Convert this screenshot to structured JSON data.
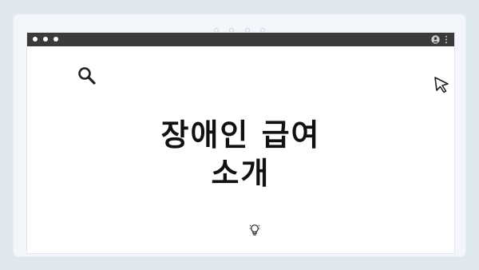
{
  "carousel": {
    "dot_count": 4
  },
  "browser_window": {
    "titlebar_buttons": [
      "dot",
      "dot",
      "dot"
    ],
    "right_icons": [
      "user-icon",
      "kebab-menu-icon"
    ]
  },
  "slide": {
    "title_line1": "장애인 급여",
    "title_line2": "소개",
    "icons": [
      "search-icon",
      "cursor-arrow-icon",
      "lightbulb-icon"
    ]
  },
  "colors": {
    "page_background": "#dfe7ef",
    "frame_background": "#f3f6fa",
    "titlebar": "#3a3a3a",
    "content_background": "#ffffff",
    "text": "#111111"
  }
}
